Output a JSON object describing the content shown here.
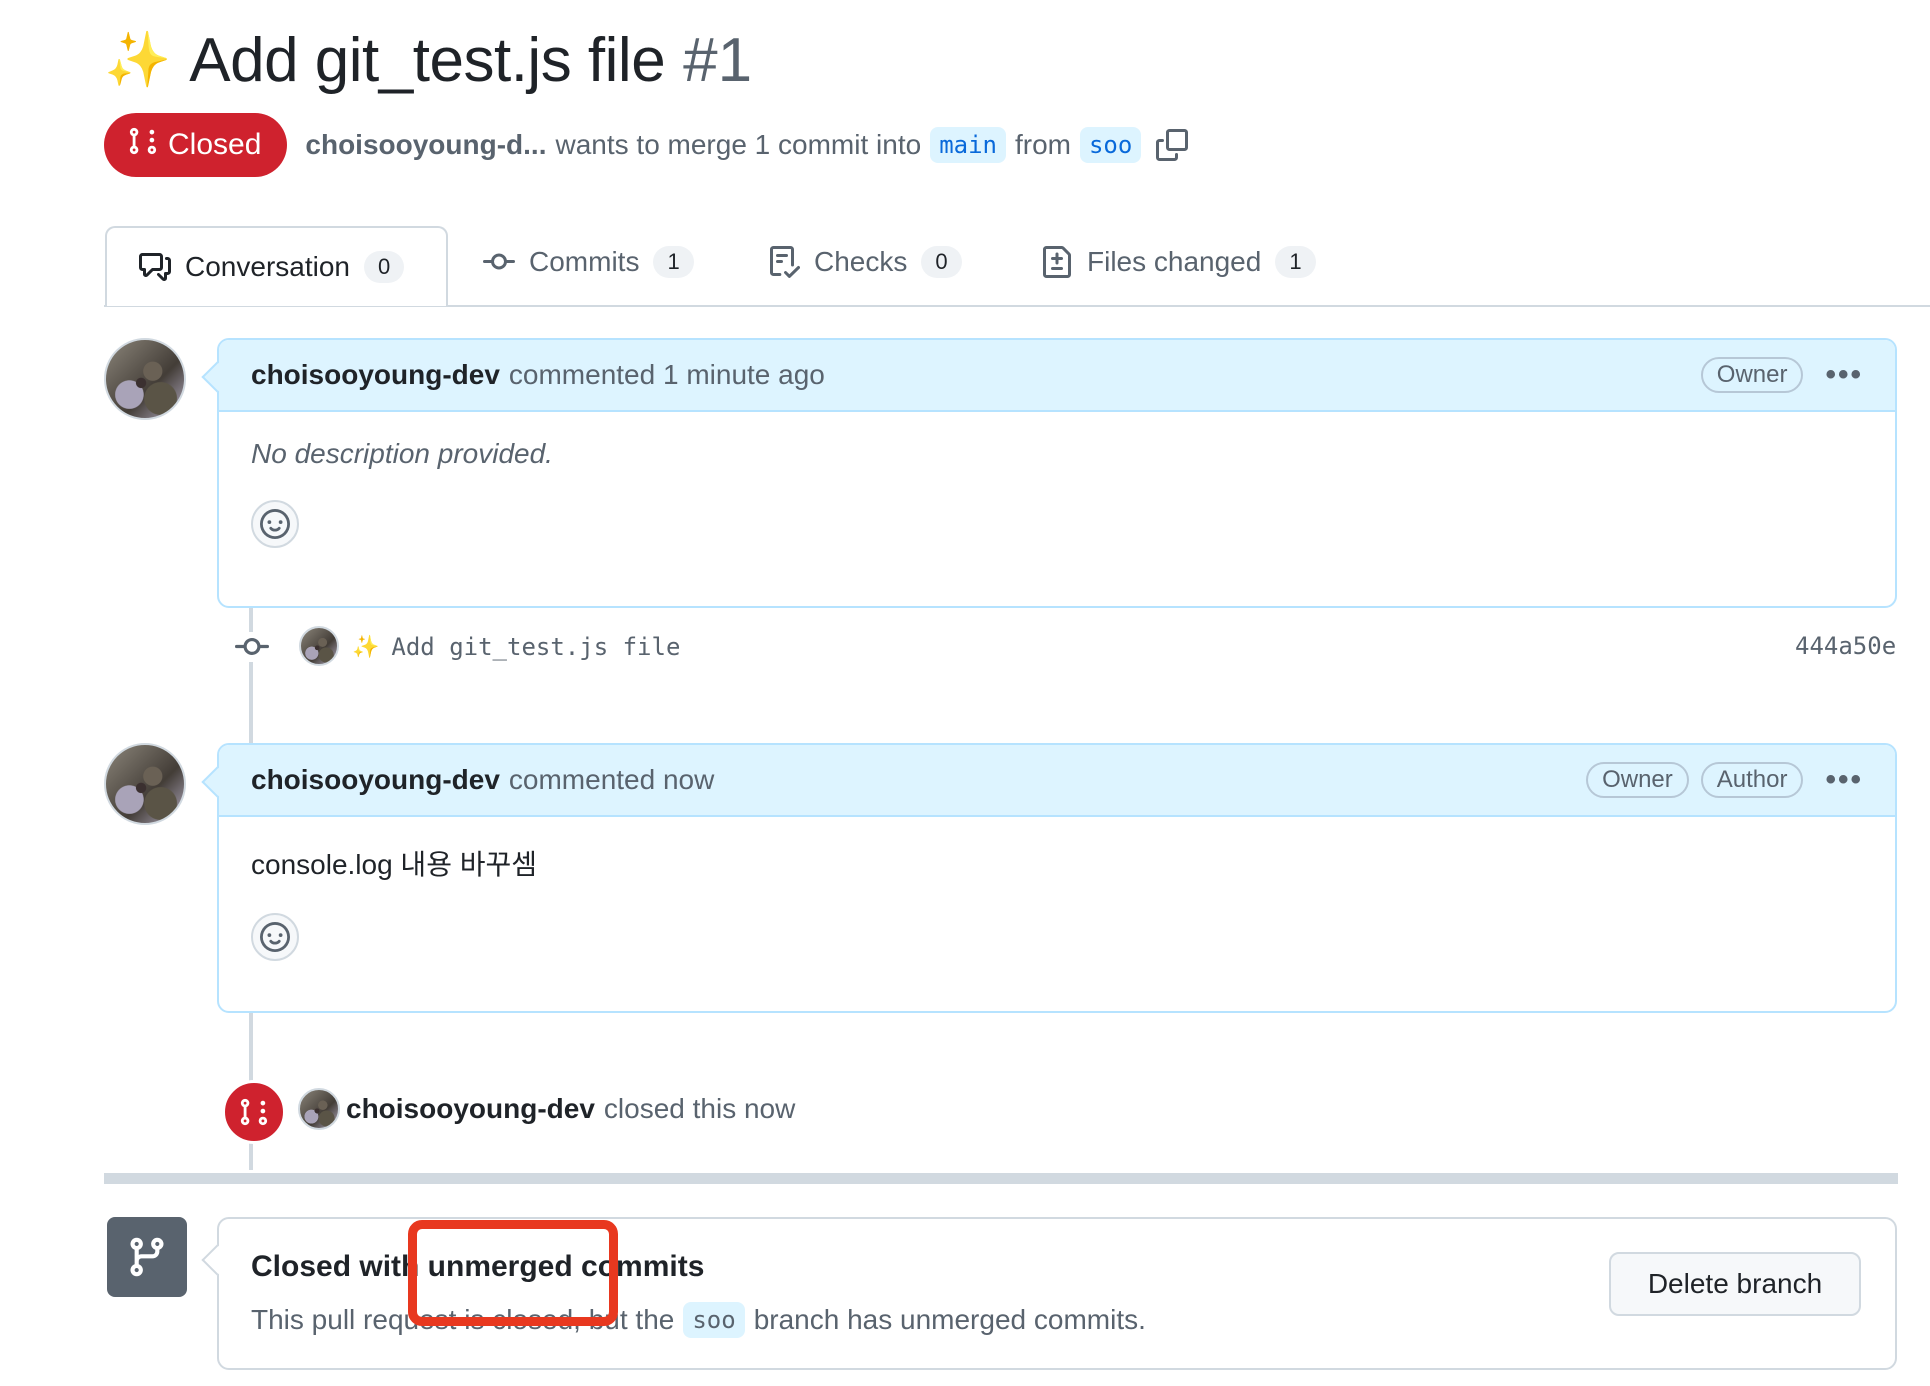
{
  "pr": {
    "emoji": "✨",
    "title": "Add git_test.js file",
    "number": "#1",
    "status": "Closed",
    "author_short": "choisooyoung-d...",
    "merge_text": "wants to merge 1 commit into",
    "base_branch": "main",
    "from_text": "from",
    "head_branch": "soo"
  },
  "tabs": [
    {
      "label": "Conversation",
      "count": "0",
      "icon": "comment-discussion-icon"
    },
    {
      "label": "Commits",
      "count": "1",
      "icon": "git-commit-icon"
    },
    {
      "label": "Checks",
      "count": "0",
      "icon": "checklist-icon"
    },
    {
      "label": "Files changed",
      "count": "1",
      "icon": "file-diff-icon"
    }
  ],
  "comments": [
    {
      "author": "choisooyoung-dev",
      "meta": "commented 1 minute ago",
      "roles": [
        "Owner"
      ],
      "body": "No description provided."
    },
    {
      "author": "choisooyoung-dev",
      "meta": "commented now",
      "roles": [
        "Owner",
        "Author"
      ],
      "body": "console.log 내용 바꾸셈"
    }
  ],
  "commit": {
    "emoji": "✨",
    "message": "Add git_test.js file",
    "sha": "444a50e"
  },
  "closed_event": {
    "actor": "choisooyoung-dev",
    "text": "closed this now"
  },
  "merge_box": {
    "title": "Closed with unmerged commits",
    "desc_prefix": "This pull request is closed, but the",
    "branch": "soo",
    "desc_suffix": "branch has unmerged commits.",
    "delete_button": "Delete branch"
  },
  "colors": {
    "closed_red": "#cf222e",
    "accent_blue": "#0969da",
    "header_blue": "#ddf4ff",
    "annotation_red": "#e8381f"
  }
}
